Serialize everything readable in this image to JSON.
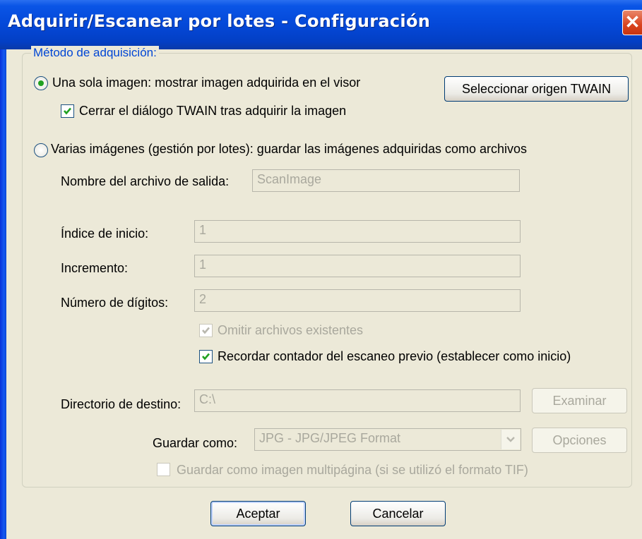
{
  "window": {
    "title": "Adquirir/Escanear por lotes - Configuración",
    "close_glyph": "✕"
  },
  "group": {
    "legend": "Método de adquisición:"
  },
  "single": {
    "label": "Una sola imagen: mostrar imagen adquirida en el visor",
    "selected": true,
    "close_twain_label": "Cerrar el diálogo TWAIN tras adquirir la imagen",
    "close_twain_checked": true,
    "select_source_button": "Seleccionar origen TWAIN"
  },
  "batch": {
    "label": "Varias imágenes (gestión por lotes): guardar las imágenes adquiridas como archivos",
    "selected": false,
    "output_name_label": "Nombre del archivo de salida:",
    "output_name_value": "ScanImage",
    "start_index_label": "Índice de inicio:",
    "start_index_value": "1",
    "increment_label": "Incremento:",
    "increment_value": "1",
    "digits_label": "Número de dígitos:",
    "digits_value": "2",
    "skip_existing_label": "Omitir archivos existentes",
    "remember_counter_label": "Recordar contador del escaneo previo (establecer como inicio)",
    "dest_dir_label": "Directorio de destino:",
    "dest_dir_value": "C:\\",
    "browse_button": "Examinar",
    "save_as_label": "Guardar como:",
    "save_as_value": "JPG - JPG/JPEG Format",
    "options_button": "Opciones",
    "multipage_label": "Guardar como imagen multipágina (si se utilizó el formato TIF)"
  },
  "footer": {
    "ok_button": "Aceptar",
    "cancel_button": "Cancelar"
  }
}
